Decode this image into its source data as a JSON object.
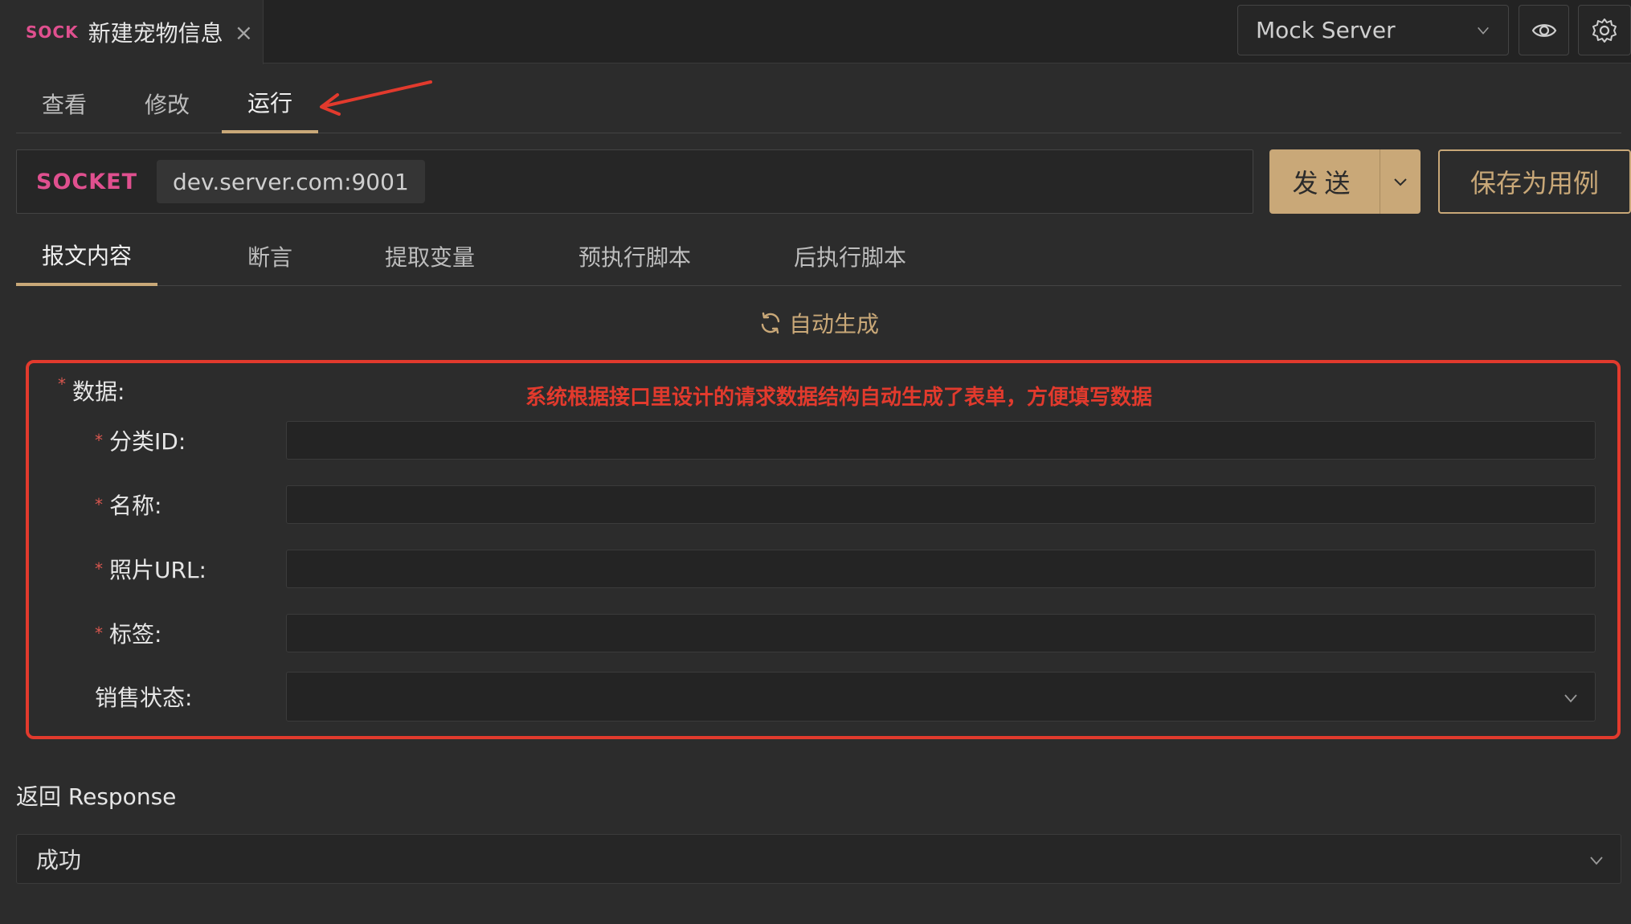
{
  "doc_tab": {
    "protocol": "SOCK",
    "title": "新建宠物信息",
    "close": "×"
  },
  "env_select": {
    "value": "Mock Server"
  },
  "mode_tabs": [
    {
      "label": "查看"
    },
    {
      "label": "修改"
    },
    {
      "label": "运行"
    }
  ],
  "request": {
    "protocol": "SOCKET",
    "url": "dev.server.com:9001"
  },
  "send_button": {
    "label": "发送"
  },
  "save_button": {
    "label": "保存为用例"
  },
  "body_tabs": [
    {
      "label": "报文内容"
    },
    {
      "label": "断言"
    },
    {
      "label": "提取变量"
    },
    {
      "label": "预执行脚本"
    },
    {
      "label": "后执行脚本"
    }
  ],
  "auto_generate": {
    "label": "自动生成"
  },
  "form": {
    "root_label": "数据:",
    "required_mark": "*",
    "annotation": "系统根据接口里设计的请求数据结构自动生成了表单，方便填写数据",
    "fields": [
      {
        "label": "分类ID:",
        "value": ""
      },
      {
        "label": "名称:",
        "value": ""
      },
      {
        "label": "照片URL:",
        "value": ""
      },
      {
        "label": "标签:",
        "value": ""
      },
      {
        "label": "销售状态:",
        "value": ""
      }
    ]
  },
  "response": {
    "label": "返回 Response",
    "value": "成功"
  },
  "colors": {
    "accent": "#c9a878",
    "protocol": "#e0508f",
    "annotation": "#e23a2d",
    "background": "#2c2c2c"
  }
}
